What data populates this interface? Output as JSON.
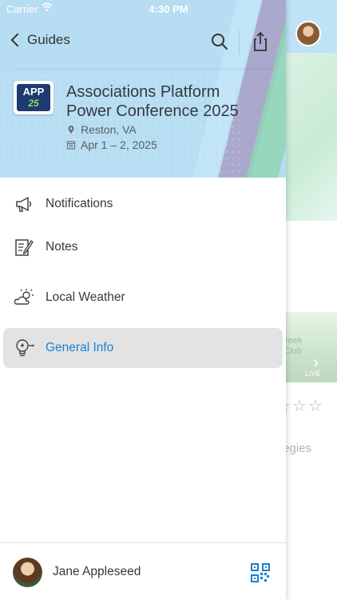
{
  "status_bar": {
    "carrier": "Carrier",
    "time": "4:30 PM"
  },
  "nav": {
    "back_label": "Guides",
    "search_icon": "search-icon",
    "share_icon": "share-icon"
  },
  "event": {
    "logo": {
      "line1": "APP",
      "line2": "25"
    },
    "title": "Associations Platform Power Conference 2025",
    "location": "Reston, VA",
    "dates": "Apr 1 – 2, 2025"
  },
  "menu": [
    {
      "label": "Notifications",
      "icon": "megaphone-icon",
      "active": false
    },
    {
      "label": "Notes",
      "icon": "notes-icon",
      "active": false
    },
    {
      "label": "Local Weather",
      "icon": "weather-icon",
      "active": false
    },
    {
      "label": "General Info",
      "icon": "lightbulb-icon",
      "active": true
    }
  ],
  "footer": {
    "user_name": "Jane Appleseed",
    "qr_icon": "qr-code-icon"
  },
  "background": {
    "venue_text_line1": "n Creek",
    "venue_text_line2": "try Club",
    "small_text": "LIVE",
    "partial_text": "tegies"
  },
  "colors": {
    "header_bg": "#b7ddf2",
    "accent": "#1a7fcf",
    "active_row_bg": "#e3e3e3",
    "logo_bg": "#1e3a6e",
    "logo_accent": "#8ee05a"
  }
}
